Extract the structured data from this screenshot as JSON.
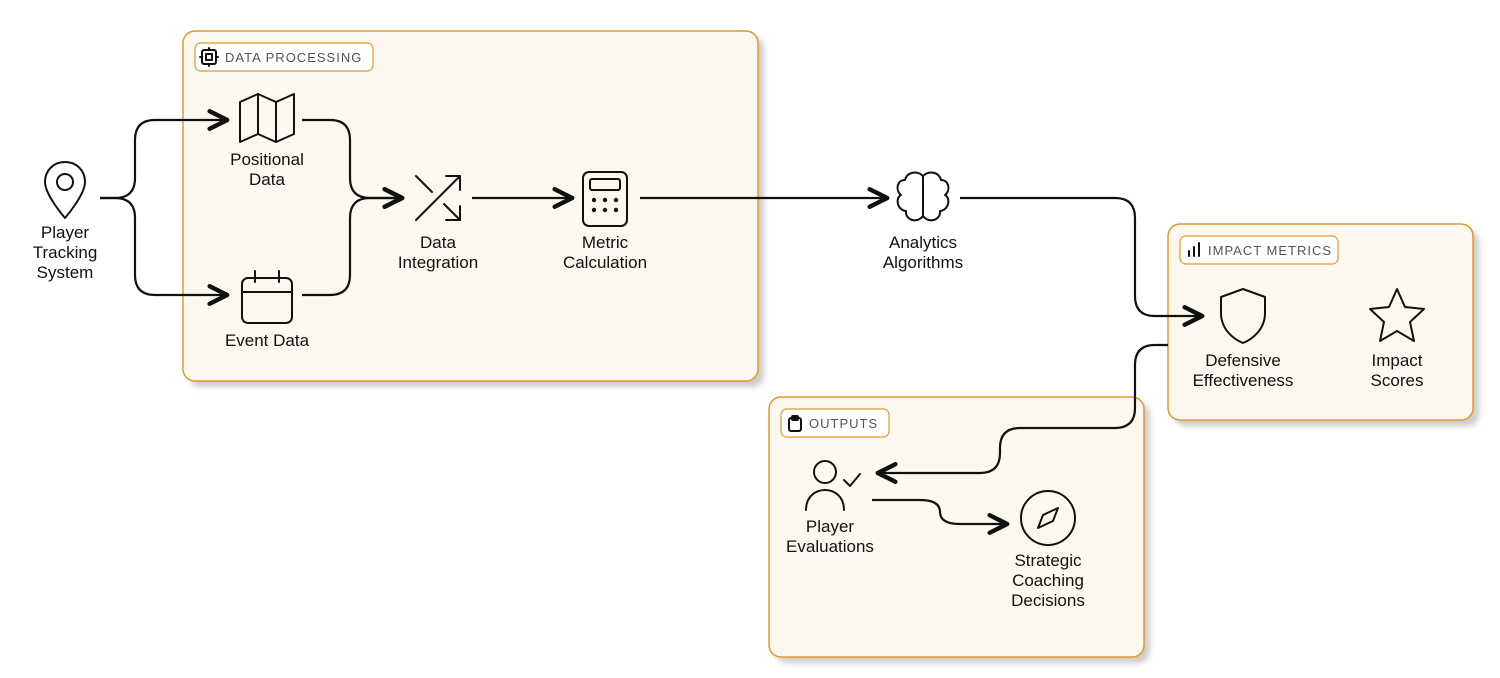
{
  "groups": {
    "data_processing": {
      "title": "DATA PROCESSING"
    },
    "impact_metrics": {
      "title": "IMPACT METRICS"
    },
    "outputs": {
      "title": "OUTPUTS"
    }
  },
  "nodes": {
    "player_tracking": {
      "l1": "Player",
      "l2": "Tracking",
      "l3": "System"
    },
    "positional_data": {
      "l1": "Positional",
      "l2": "Data"
    },
    "event_data": {
      "l1": "Event Data"
    },
    "data_integration": {
      "l1": "Data",
      "l2": "Integration"
    },
    "metric_calculation": {
      "l1": "Metric",
      "l2": "Calculation"
    },
    "analytics_algorithms": {
      "l1": "Analytics",
      "l2": "Algorithms"
    },
    "defensive_effectiveness": {
      "l1": "Defensive",
      "l2": "Effectiveness"
    },
    "impact_scores": {
      "l1": "Impact",
      "l2": "Scores"
    },
    "player_evaluations": {
      "l1": "Player",
      "l2": "Evaluations"
    },
    "strategic_coaching": {
      "l1": "Strategic",
      "l2": "Coaching",
      "l3": "Decisions"
    }
  }
}
